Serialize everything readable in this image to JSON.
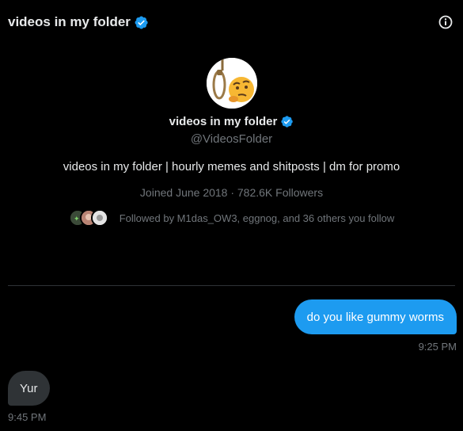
{
  "header": {
    "title": "videos in my folder",
    "verified_icon": "verified-badge-icon",
    "info_icon": "info-icon"
  },
  "profile": {
    "name": "videos in my folder",
    "handle": "@VideosFolder",
    "bio": "videos in my folder | hourly memes and shitposts | dm for promo",
    "meta": "Joined June 2018 · 782.6K Followers",
    "followed_by": "Followed by M1das_OW3, eggnog, and 36 others you follow"
  },
  "messages": [
    {
      "direction": "outgoing",
      "text": "do you like gummy worms",
      "time": "9:25 PM"
    },
    {
      "direction": "incoming",
      "text": "Yur",
      "time": "9:45 PM"
    }
  ],
  "colors": {
    "background": "#000000",
    "accent": "#1d9bf0",
    "incoming_bubble": "#2f3336",
    "muted_text": "#71767b"
  }
}
